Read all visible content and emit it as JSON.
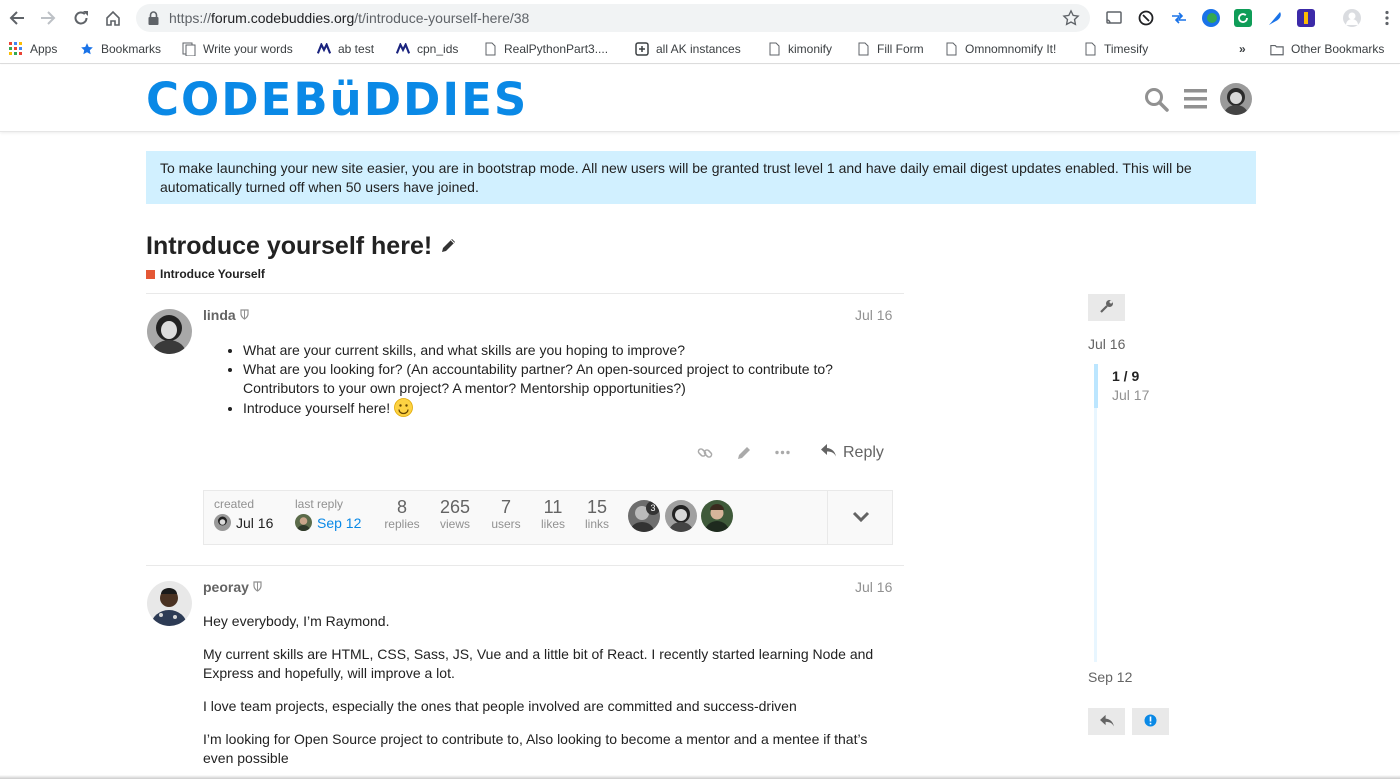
{
  "browser": {
    "url_host": "forum.codebuddies.org",
    "url_scheme": "https://",
    "url_path": "/t/introduce-yourself-here/38",
    "bookmarks": [
      {
        "label": "Apps",
        "icon": "apps-grid-icon"
      },
      {
        "label": "Bookmarks",
        "icon": "star-icon"
      },
      {
        "label": "Write your words",
        "icon": "doc-icon"
      },
      {
        "label": "ab test",
        "icon": "m-icon"
      },
      {
        "label": "cpn_ids",
        "icon": "m-icon"
      },
      {
        "label": "RealPythonPart3....",
        "icon": "page-icon"
      },
      {
        "label": "all AK instances",
        "icon": "plus-box-icon"
      },
      {
        "label": "kimonify",
        "icon": "page-icon"
      },
      {
        "label": "Fill Form",
        "icon": "page-icon"
      },
      {
        "label": "Omnomnomify It!",
        "icon": "page-icon"
      },
      {
        "label": "Timesify",
        "icon": "page-icon"
      }
    ],
    "overflow": "»",
    "other_bookmarks": "Other Bookmarks"
  },
  "site": {
    "logo": "CODEBüDDIES",
    "accent": "#0a89e6"
  },
  "notice": "To make launching your new site easier, you are in bootstrap mode. All new users will be granted trust level 1 and have daily email digest updates enabled. This will be automatically turned off when 50 users have joined.",
  "topic": {
    "title": "Introduce yourself here!",
    "category": "Introduce Yourself",
    "category_color": "#e45735"
  },
  "posts": [
    {
      "username": "linda",
      "date": "Jul 16",
      "bullets": [
        "What are your current skills, and what skills are you hoping to improve?",
        "What are you looking for? (An accountability partner? An open-sourced project to contribute to? Contributors to your own project? A mentor? Mentorship opportunities?)",
        "Introduce yourself here!"
      ],
      "reply_label": "Reply"
    },
    {
      "username": "peoray",
      "date": "Jul 16",
      "paragraphs": [
        "Hey everybody, I’m Raymond.",
        "My current skills are HTML, CSS, Sass, JS, Vue and a little bit of React. I recently started learning Node and Express and hopefully, will improve a lot.",
        "I love team projects, especially the ones that people involved are committed and success-driven",
        "I’m looking for Open Source project to contribute to, Also looking to become a mentor and a mentee if that’s even possible"
      ]
    }
  ],
  "topic_map": {
    "created_label": "created",
    "created_date": "Jul 16",
    "last_reply_label": "last reply",
    "last_reply_date": "Sep 12",
    "stats": [
      {
        "value": "8",
        "label": "replies"
      },
      {
        "value": "265",
        "label": "views"
      },
      {
        "value": "7",
        "label": "users"
      },
      {
        "value": "11",
        "label": "likes"
      },
      {
        "value": "15",
        "label": "links"
      }
    ],
    "participant_badge": "3"
  },
  "timeline": {
    "start_date": "Jul 16",
    "position": "1 / 9",
    "position_date": "Jul 17",
    "end_date": "Sep 12"
  }
}
